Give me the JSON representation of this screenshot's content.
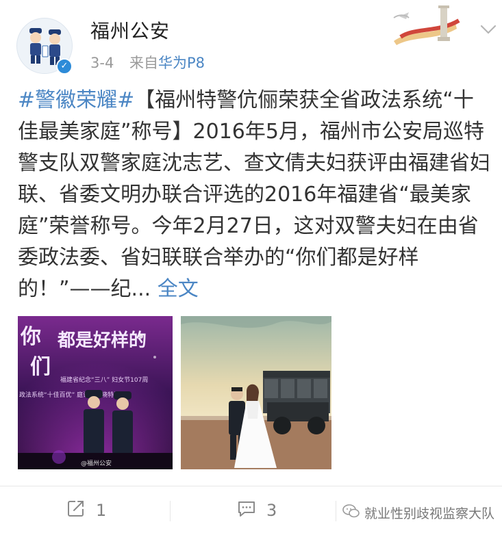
{
  "post": {
    "author": "福州公安",
    "date": "3-4",
    "source_prefix": "来自",
    "source_device": "华为P8",
    "hashtag": "#警徽荣耀#",
    "body": "【福州特警伉俪荣获全省政法系统“十佳最美家庭”称号】2016年5月，福州市公安局巡特警支队双警家庭沈志艺、查文倩夫妇获评由福建省妇联、省委文明办联合评选的2016年福建省“最美家庭”荣誉称号。今年2月27日，这对双警夫妇在由省委政法委、省妇联联合举办的“你们都是好样的！”——纪...",
    "more_link": "全文",
    "images": {
      "img1": {
        "big_text_1": "你",
        "big_text_2": "们",
        "big_text_3": "都是好样的",
        "sub_text": "福建省纪念“三八” 妇女节107周",
        "sub_text_2": "政法系统“十佳百优” 庭评选揭晓特别",
        "watermark": "@福州公安"
      }
    }
  },
  "actions": {
    "repost_count": "1",
    "comment_count": "3"
  },
  "wechat_watermark": "就业性别歧视监察大队",
  "colors": {
    "link": "#4b86c4",
    "text": "#333333",
    "meta": "#9a9a9a",
    "verified": "#2d8bd8"
  }
}
